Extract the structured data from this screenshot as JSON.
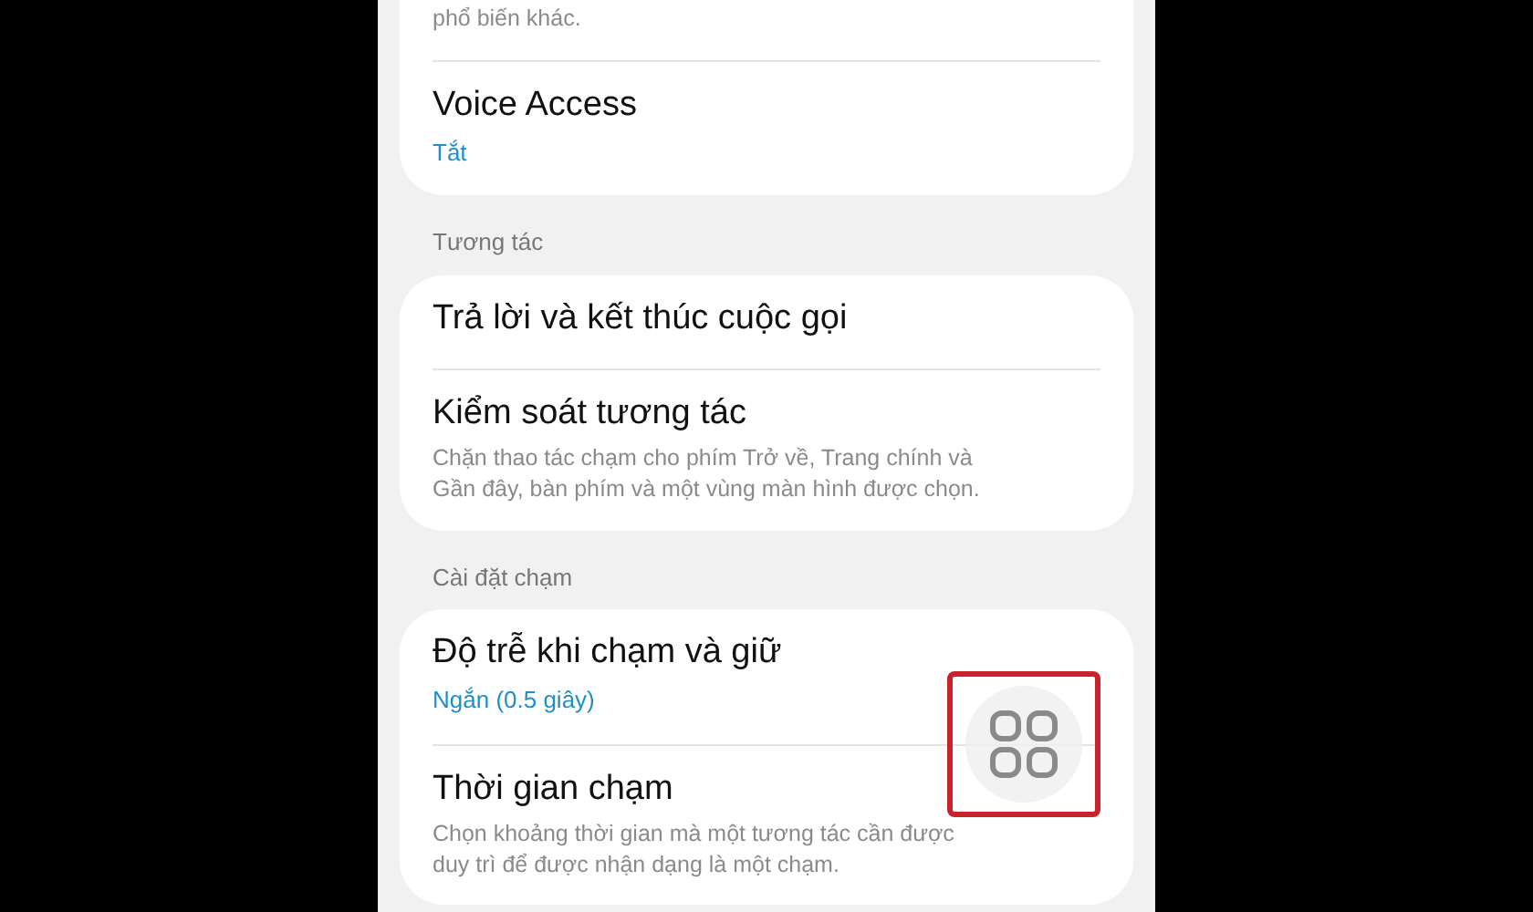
{
  "groups": [
    {
      "items": [
        {
          "description": "phổ biến khác."
        },
        {
          "title": "Voice Access",
          "value": "Tắt"
        }
      ]
    },
    {
      "header": "Tương tác",
      "items": [
        {
          "title": "Trả lời và kết thúc cuộc gọi"
        },
        {
          "title": "Kiểm soát tương tác",
          "description": "Chặn thao tác chạm cho phím Trở về, Trang chính và Gần đây, bàn phím và một vùng màn hình được chọn."
        }
      ]
    },
    {
      "header": "Cài đặt chạm",
      "items": [
        {
          "title": "Độ trễ khi chạm và giữ",
          "value": "Ngắn (0.5 giây)"
        },
        {
          "title": "Thời gian chạm",
          "description": "Chọn khoảng thời gian mà một tương tác cần được duy trì để được nhận dạng là một chạm."
        }
      ]
    }
  ]
}
